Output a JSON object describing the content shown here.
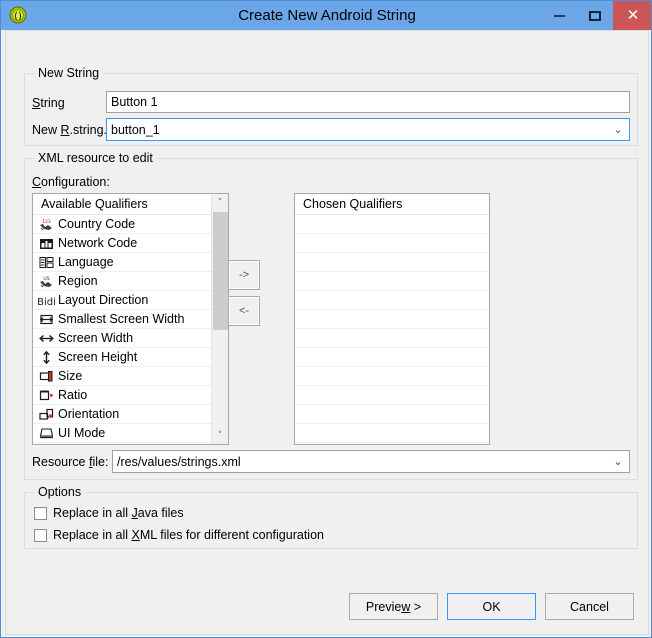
{
  "window": {
    "title": "Create New Android String",
    "icon": "android-string-resource-icon",
    "controls": {
      "minimize": "minimize-icon",
      "maximize": "maximize-icon",
      "close": "✕"
    },
    "accent_color": "#6ba7e8",
    "close_color": "#cc5555",
    "body_color": "#f0f0f0"
  },
  "new_string_group": {
    "legend": "New String",
    "string_label_pre": "S",
    "string_label_post": "tring",
    "string_value": "Button 1",
    "rstring_label_pre": "New ",
    "rstring_label_mn": "R",
    "rstring_label_post": ".string.",
    "rstring_value": "button_1",
    "chevron": "⌄"
  },
  "xml_group": {
    "legend": "XML resource to edit",
    "configuration_label_mn": "C",
    "configuration_label_post": "onfiguration:",
    "available_header": "Available Qualifiers",
    "chosen_header": "Chosen Qualifiers",
    "available_qualifiers": [
      {
        "label": "Country Code",
        "icon": "country-code-icon"
      },
      {
        "label": "Network Code",
        "icon": "network-code-icon"
      },
      {
        "label": "Language",
        "icon": "language-icon"
      },
      {
        "label": "Region",
        "icon": "region-icon"
      },
      {
        "label": "Layout Direction",
        "icon": "layout-direction-icon"
      },
      {
        "label": "Smallest Screen Width",
        "icon": "smallest-screen-width-icon"
      },
      {
        "label": "Screen Width",
        "icon": "screen-width-icon"
      },
      {
        "label": "Screen Height",
        "icon": "screen-height-icon"
      },
      {
        "label": "Size",
        "icon": "size-icon"
      },
      {
        "label": "Ratio",
        "icon": "ratio-icon"
      },
      {
        "label": "Orientation",
        "icon": "orientation-icon"
      },
      {
        "label": "UI Mode",
        "icon": "ui-mode-icon"
      }
    ],
    "chosen_qualifiers": [],
    "move_right_label": "->",
    "move_left_label": "<-",
    "scroll_up": "˄",
    "scroll_down": "˅",
    "resource_file_label_pre": "Resource ",
    "resource_file_label_mn": "f",
    "resource_file_label_post": "ile:",
    "resource_file_value": "/res/values/strings.xml",
    "resource_file_chevron": "⌄"
  },
  "options_group": {
    "legend": "Options",
    "java_pre": "Replace in all ",
    "java_mn": "J",
    "java_post": "ava files",
    "java_checked": false,
    "xml_pre": "Replace in all ",
    "xml_mn": "X",
    "xml_post": "ML files for different configuration",
    "xml_checked": false
  },
  "footer": {
    "preview_pre": "Previe",
    "preview_mn": "w",
    "preview_post": " >",
    "ok": "OK",
    "cancel": "Cancel"
  }
}
